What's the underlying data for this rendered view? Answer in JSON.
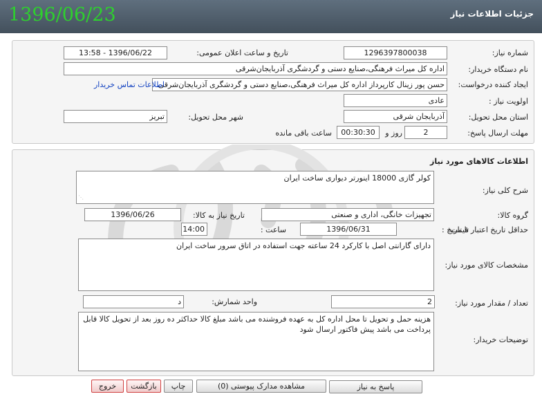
{
  "header": {
    "title": "جزئیات اطلاعات نیاز",
    "date": "1396/06/23"
  },
  "info": {
    "need_number_label": "شماره نیاز:",
    "need_number": "1296397800038",
    "announce_label": "تاریخ و ساعت اعلان عمومی:",
    "announce_value": "1396/06/22 - 13:58",
    "buyer_org_label": "نام دستگاه خریدار:",
    "buyer_org": "اداره کل میراث فرهنگی،صنایع دستی و گردشگری آذربایجان‌شرقی",
    "requester_label": "ایجاد کننده درخواست:",
    "requester": "حسن پور زینال کارپرداز اداره کل میراث فرهنگی،صنایع دستی و گردشگری آذربایجان‌شرقی",
    "contact_link": "اطلاعات تماس خریدار",
    "priority_label": "اولویت نیاز :",
    "priority": "عادی",
    "province_label": "استان محل تحویل:",
    "province": "آذربایجان شرقی",
    "city_label": "شهر محل تحویل:",
    "city": "تبریز",
    "deadline_label": "مهلت ارسال پاسخ:",
    "deadline_days": "2",
    "days_word": "روز و",
    "deadline_time": "00:30:30",
    "remaining_word": "ساعت باقی مانده"
  },
  "goods": {
    "section_title": "اطلاعات کالاهای مورد نیاز",
    "general_desc_label": "شرح کلی نیاز:",
    "general_desc": "کولر گازی 18000 اینورتر دیواری ساخت ایران",
    "group_label": "گروه کالا:",
    "group_value": "تجهیزات خانگی، اداری و صنعتی",
    "need_date_label": "تاریخ نیاز به کالا:",
    "need_date": "1396/06/26",
    "validity_label": "حداقل تاریخ اعتبار قیمت:",
    "until_date_label": "تا تاریخ :",
    "until_date": "1396/06/31",
    "time_label": "ساعت :",
    "time_value": "14:00",
    "specs_label": "مشخصات کالای مورد نیاز:",
    "specs": "دارای گارانتی اصل با کارکرد 24 ساعته جهت استفاده در اتاق سرور ساخت ایران",
    "quantity_label": "تعداد / مقدار مورد نیاز:",
    "quantity": "2",
    "unit_label": "واحد شمارش:",
    "unit": "د",
    "buyer_notes_label": "توضیحات خریدار:",
    "buyer_notes": "هزینه حمل و تحویل تا محل اداره کل به عهده فروشنده می باشد مبلغ کالا حداکثر ده روز بعد از تحویل کالا قابل پرداخت می باشد پیش فاکتور ارسال شود"
  },
  "buttons": {
    "reply": "پاسخ به نیاز",
    "attachments": "مشاهده مدارک پیوستی (0)",
    "print": "چاپ",
    "back": "بازگشت",
    "exit": "خروج"
  }
}
